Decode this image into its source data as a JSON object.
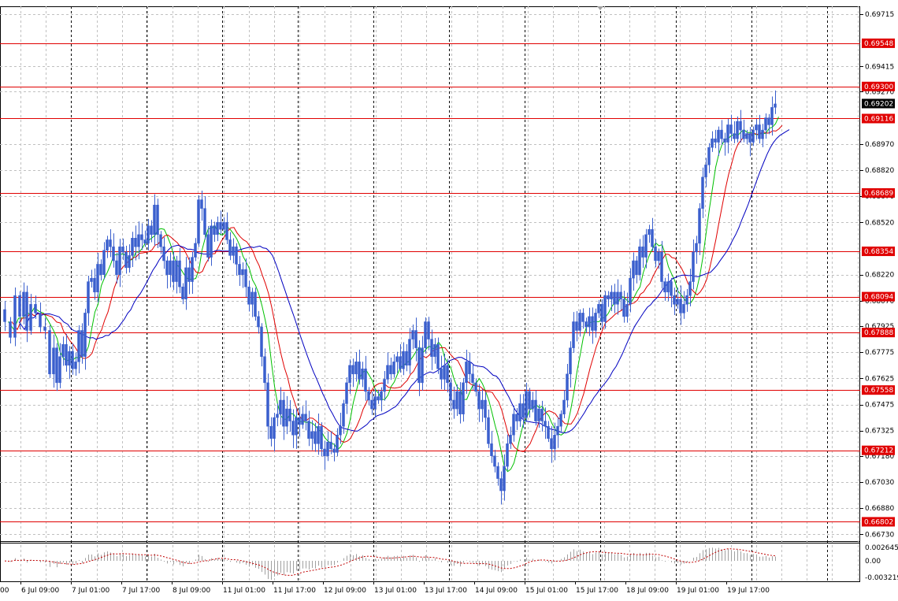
{
  "chart_data": {
    "type": "candlestick",
    "title": "",
    "grid": true,
    "price_ticks": [
      "0.69715",
      "0.69415",
      "0.69270",
      "0.68970",
      "0.68820",
      "0.68670",
      "0.68520",
      "0.68220",
      "0.68070",
      "0.67925",
      "0.67775",
      "0.67625",
      "0.67475",
      "0.67325",
      "0.67180",
      "0.67030",
      "0.66880",
      "0.66730"
    ],
    "horizontal_levels": [
      "0.69548",
      "0.69300",
      "0.69116",
      "0.68689",
      "0.68354",
      "0.68094",
      "0.67888",
      "0.67558",
      "0.67212",
      "0.66802"
    ],
    "current_price": "0.69202",
    "ylim": [
      0.667,
      0.6976
    ],
    "time_labels": [
      "6 Jul 09:00",
      "7 Jul 01:00",
      "7 Jul 17:00",
      "8 Jul 09:00",
      "11 Jul 01:00",
      "11 Jul 17:00",
      "12 Jul 09:00",
      "13 Jul 01:00",
      "13 Jul 17:00",
      "14 Jul 09:00",
      "15 Jul 01:00",
      "15 Jul 17:00",
      "18 Jul 09:00",
      "19 Jul 01:00",
      "19 Jul 17:00"
    ],
    "first_label_fragment": "00",
    "price_path": [
      [
        0,
        0.6802
      ],
      [
        8,
        0.6795
      ],
      [
        14,
        0.6786
      ],
      [
        20,
        0.681
      ],
      [
        26,
        0.6798
      ],
      [
        30,
        0.6812
      ],
      [
        34,
        0.679
      ],
      [
        40,
        0.6805
      ],
      [
        46,
        0.68
      ],
      [
        52,
        0.6792
      ],
      [
        58,
        0.679
      ],
      [
        64,
        0.6765
      ],
      [
        68,
        0.678
      ],
      [
        72,
        0.676
      ],
      [
        76,
        0.6775
      ],
      [
        80,
        0.6782
      ],
      [
        84,
        0.677
      ],
      [
        88,
        0.6778
      ],
      [
        92,
        0.6768
      ],
      [
        96,
        0.6772
      ],
      [
        100,
        0.679
      ],
      [
        104,
        0.6775
      ],
      [
        108,
        0.68
      ],
      [
        112,
        0.6818
      ],
      [
        116,
        0.682
      ],
      [
        120,
        0.6812
      ],
      [
        124,
        0.6828
      ],
      [
        128,
        0.6822
      ],
      [
        132,
        0.6836
      ],
      [
        136,
        0.6842
      ],
      [
        140,
        0.6838
      ],
      [
        144,
        0.683
      ],
      [
        148,
        0.6822
      ],
      [
        152,
        0.6838
      ],
      [
        156,
        0.6835
      ],
      [
        160,
        0.6826
      ],
      [
        164,
        0.6833
      ],
      [
        168,
        0.6843
      ],
      [
        172,
        0.6838
      ],
      [
        176,
        0.6845
      ],
      [
        180,
        0.6842
      ],
      [
        184,
        0.684
      ],
      [
        188,
        0.685
      ],
      [
        192,
        0.6845
      ],
      [
        196,
        0.6862
      ],
      [
        200,
        0.6845
      ],
      [
        204,
        0.6838
      ],
      [
        208,
        0.683
      ],
      [
        212,
        0.6822
      ],
      [
        216,
        0.683
      ],
      [
        220,
        0.6818
      ],
      [
        224,
        0.683
      ],
      [
        228,
        0.6815
      ],
      [
        232,
        0.6808
      ],
      [
        236,
        0.6826
      ],
      [
        240,
        0.6818
      ],
      [
        244,
        0.6832
      ],
      [
        248,
        0.684
      ],
      [
        252,
        0.6865
      ],
      [
        256,
        0.686
      ],
      [
        260,
        0.6845
      ],
      [
        264,
        0.6832
      ],
      [
        268,
        0.685
      ],
      [
        272,
        0.6845
      ],
      [
        276,
        0.6852
      ],
      [
        280,
        0.6848
      ],
      [
        284,
        0.6852
      ],
      [
        288,
        0.6842
      ],
      [
        292,
        0.6833
      ],
      [
        296,
        0.6838
      ],
      [
        300,
        0.6828
      ],
      [
        304,
        0.6822
      ],
      [
        308,
        0.6825
      ],
      [
        312,
        0.6815
      ],
      [
        316,
        0.6805
      ],
      [
        320,
        0.6812
      ],
      [
        324,
        0.6798
      ],
      [
        328,
        0.6792
      ],
      [
        332,
        0.6775
      ],
      [
        336,
        0.676
      ],
      [
        340,
        0.6735
      ],
      [
        344,
        0.6728
      ],
      [
        348,
        0.674
      ],
      [
        352,
        0.6742
      ],
      [
        356,
        0.675
      ],
      [
        360,
        0.6735
      ],
      [
        364,
        0.6745
      ],
      [
        368,
        0.6738
      ],
      [
        372,
        0.673
      ],
      [
        376,
        0.674
      ],
      [
        380,
        0.6736
      ],
      [
        384,
        0.6742
      ],
      [
        388,
        0.6738
      ],
      [
        392,
        0.6728
      ],
      [
        396,
        0.6732
      ],
      [
        400,
        0.6725
      ],
      [
        404,
        0.6735
      ],
      [
        408,
        0.6722
      ],
      [
        412,
        0.6718
      ],
      [
        416,
        0.6726
      ],
      [
        420,
        0.6722
      ],
      [
        424,
        0.672
      ],
      [
        428,
        0.673
      ],
      [
        432,
        0.6735
      ],
      [
        436,
        0.6748
      ],
      [
        440,
        0.676
      ],
      [
        444,
        0.677
      ],
      [
        448,
        0.6765
      ],
      [
        452,
        0.6772
      ],
      [
        456,
        0.6762
      ],
      [
        460,
        0.6768
      ],
      [
        464,
        0.6755
      ],
      [
        468,
        0.675
      ],
      [
        472,
        0.6745
      ],
      [
        476,
        0.6752
      ],
      [
        480,
        0.675
      ],
      [
        484,
        0.6755
      ],
      [
        488,
        0.6762
      ],
      [
        492,
        0.677
      ],
      [
        496,
        0.6765
      ],
      [
        500,
        0.6772
      ],
      [
        504,
        0.6775
      ],
      [
        508,
        0.6768
      ],
      [
        512,
        0.6778
      ],
      [
        516,
        0.677
      ],
      [
        520,
        0.6785
      ],
      [
        524,
        0.679
      ],
      [
        528,
        0.678
      ],
      [
        532,
        0.676
      ],
      [
        536,
        0.678
      ],
      [
        540,
        0.6795
      ],
      [
        544,
        0.6785
      ],
      [
        548,
        0.6775
      ],
      [
        552,
        0.6782
      ],
      [
        556,
        0.6768
      ],
      [
        560,
        0.6762
      ],
      [
        564,
        0.677
      ],
      [
        568,
        0.676
      ],
      [
        572,
        0.675
      ],
      [
        576,
        0.6745
      ],
      [
        580,
        0.6755
      ],
      [
        584,
        0.6742
      ],
      [
        588,
        0.676
      ],
      [
        592,
        0.6772
      ],
      [
        596,
        0.6765
      ],
      [
        600,
        0.676
      ],
      [
        604,
        0.6755
      ],
      [
        608,
        0.6745
      ],
      [
        612,
        0.675
      ],
      [
        616,
        0.674
      ],
      [
        620,
        0.6725
      ],
      [
        624,
        0.6718
      ],
      [
        628,
        0.6712
      ],
      [
        632,
        0.6705
      ],
      [
        636,
        0.6698
      ],
      [
        640,
        0.6712
      ],
      [
        644,
        0.6725
      ],
      [
        648,
        0.673
      ],
      [
        652,
        0.6742
      ],
      [
        656,
        0.6738
      ],
      [
        660,
        0.6748
      ],
      [
        664,
        0.674
      ],
      [
        668,
        0.6755
      ],
      [
        672,
        0.6745
      ],
      [
        676,
        0.675
      ],
      [
        680,
        0.6738
      ],
      [
        684,
        0.6745
      ],
      [
        688,
        0.6738
      ],
      [
        692,
        0.6735
      ],
      [
        696,
        0.6728
      ],
      [
        700,
        0.6722
      ],
      [
        704,
        0.673
      ],
      [
        708,
        0.6735
      ],
      [
        712,
        0.6742
      ],
      [
        716,
        0.675
      ],
      [
        720,
        0.6765
      ],
      [
        724,
        0.678
      ],
      [
        728,
        0.6795
      ],
      [
        732,
        0.679
      ],
      [
        736,
        0.68
      ],
      [
        740,
        0.6795
      ],
      [
        744,
        0.6792
      ],
      [
        748,
        0.6798
      ],
      [
        752,
        0.679
      ],
      [
        756,
        0.68
      ],
      [
        760,
        0.6805
      ],
      [
        764,
        0.6795
      ],
      [
        768,
        0.681
      ],
      [
        772,
        0.6808
      ],
      [
        776,
        0.6812
      ],
      [
        780,
        0.6805
      ],
      [
        784,
        0.6812
      ],
      [
        788,
        0.6808
      ],
      [
        792,
        0.6798
      ],
      [
        796,
        0.6805
      ],
      [
        800,
        0.682
      ],
      [
        804,
        0.683
      ],
      [
        808,
        0.6822
      ],
      [
        812,
        0.6838
      ],
      [
        816,
        0.6832
      ],
      [
        820,
        0.6845
      ],
      [
        824,
        0.6848
      ],
      [
        828,
        0.6838
      ],
      [
        832,
        0.683
      ],
      [
        836,
        0.6835
      ],
      [
        840,
        0.6818
      ],
      [
        844,
        0.6812
      ],
      [
        848,
        0.6818
      ],
      [
        852,
        0.681
      ],
      [
        856,
        0.6805
      ],
      [
        860,
        0.6808
      ],
      [
        864,
        0.68
      ],
      [
        868,
        0.6805
      ],
      [
        872,
        0.681
      ],
      [
        876,
        0.6818
      ],
      [
        880,
        0.6835
      ],
      [
        884,
        0.684
      ],
      [
        888,
        0.686
      ],
      [
        892,
        0.6878
      ],
      [
        896,
        0.6885
      ],
      [
        900,
        0.6895
      ],
      [
        904,
        0.69
      ],
      [
        908,
        0.6898
      ],
      [
        912,
        0.6905
      ],
      [
        916,
        0.69
      ],
      [
        920,
        0.6898
      ],
      [
        924,
        0.6908
      ],
      [
        928,
        0.6903
      ],
      [
        932,
        0.69
      ],
      [
        936,
        0.691
      ],
      [
        940,
        0.6905
      ],
      [
        944,
        0.69
      ],
      [
        948,
        0.6903
      ],
      [
        952,
        0.6898
      ],
      [
        956,
        0.6905
      ],
      [
        960,
        0.6908
      ],
      [
        964,
        0.69
      ],
      [
        968,
        0.6905
      ],
      [
        972,
        0.6912
      ],
      [
        976,
        0.6908
      ],
      [
        980,
        0.6918
      ],
      [
        984,
        0.692
      ]
    ],
    "ma_periods": [
      5,
      10,
      20
    ],
    "ma_colors": [
      "#00c000",
      "#e00000",
      "#0000c0"
    ],
    "oscillator": {
      "ticks": [
        "0.002645",
        "0.00",
        "-0.003219"
      ],
      "ylim": [
        -0.004,
        0.0034
      ],
      "histogram_color": "#a0a0a0",
      "signal_color": "#c00000"
    },
    "colors": {
      "candle": "#3a5fcd",
      "level_line": "#e00000",
      "level_label_bg": "#e00000",
      "current_label_bg": "#000000",
      "grid": "#c0c0c0",
      "vsep": "#000000"
    }
  }
}
